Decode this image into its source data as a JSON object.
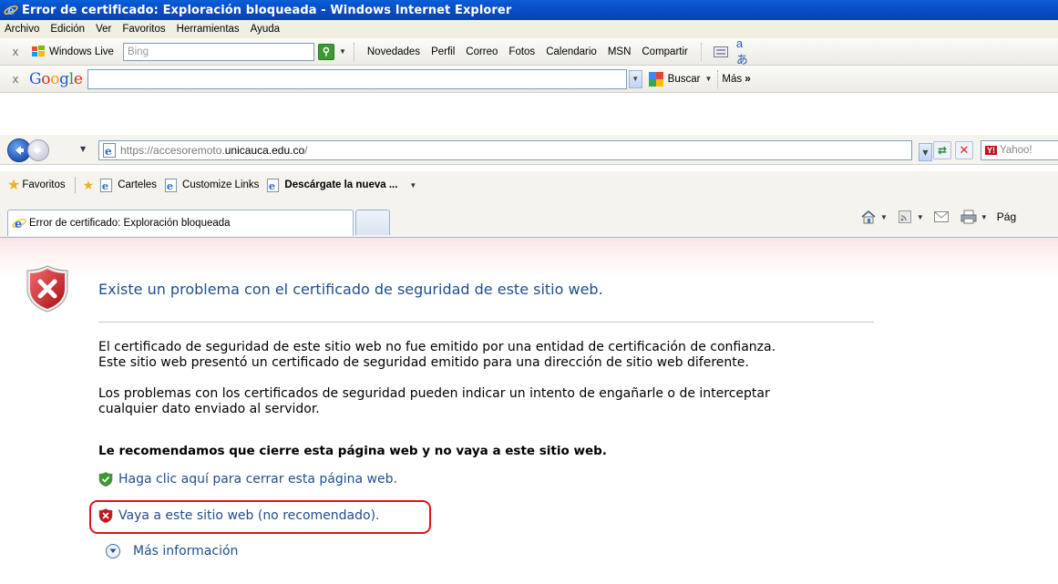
{
  "window": {
    "title": "Error de certificado: Exploración bloqueada - Windows Internet Explorer"
  },
  "menu": {
    "items": [
      "Archivo",
      "Edición",
      "Ver",
      "Favoritos",
      "Herramientas",
      "Ayuda"
    ]
  },
  "live_toolbar": {
    "brand": "Windows Live",
    "search_placeholder": "Bing",
    "links": [
      "Novedades",
      "Perfil",
      "Correo",
      "Fotos",
      "Calendario",
      "MSN",
      "Compartir"
    ]
  },
  "google_toolbar": {
    "logo": "Google",
    "search_button": "Buscar",
    "more": "Más"
  },
  "address_bar": {
    "url_prefix": "https://accesoremoto.",
    "url_domain": "unicauca.edu.co",
    "url_suffix": "/",
    "search_provider": "Yahoo!"
  },
  "favorites_bar": {
    "label": "Favoritos",
    "links": [
      "Carteles",
      "Customize Links",
      "Descárgate la nueva ..."
    ]
  },
  "tabs": {
    "active_title": "Error de certificado: Exploración bloqueada",
    "page_menu_label": "Pág"
  },
  "content": {
    "heading": "Existe un problema con el certificado de seguridad de este sitio web.",
    "paragraph1_line1": "El certificado de seguridad de este sitio web no fue emitido por una entidad de certificación de confianza.",
    "paragraph1_line2": "Este sitio web presentó un certificado de seguridad emitido para una dirección de sitio web diferente.",
    "paragraph2_line1": "Los problemas con los certificados de seguridad pueden indicar un intento de engañarle o de interceptar",
    "paragraph2_line2": "cualquier dato enviado al servidor.",
    "recommendation": "Le recomendamos que cierre esta página web y no vaya a este sitio web.",
    "close_link": "Haga clic aquí para cerrar esta página web.",
    "continue_link": "Vaya a este sitio web (no recomendado).",
    "more_info": "Más información"
  },
  "colors": {
    "title_bar": "#0a4ec6",
    "link_blue": "#1f4e8c",
    "highlight_red": "#e0151a",
    "error_red": "#c8161d",
    "safe_green": "#3a9a2e"
  },
  "icons": [
    "ie-icon",
    "windows-live-flag-icon",
    "search-go-icon",
    "google-logo",
    "back-icon",
    "forward-icon",
    "page-icon",
    "refresh-icon",
    "stop-icon",
    "favorites-star-icon",
    "home-icon",
    "feeds-icon",
    "mail-icon",
    "print-icon",
    "error-shield-icon",
    "green-shield-icon",
    "red-shield-icon",
    "expand-circle-icon"
  ]
}
